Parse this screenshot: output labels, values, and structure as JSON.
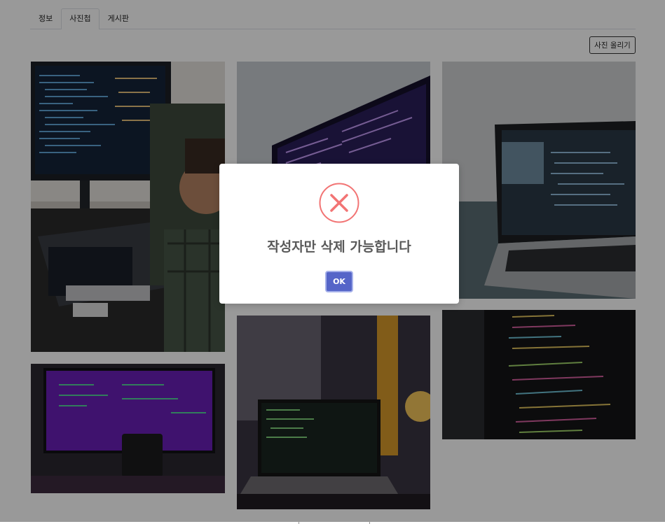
{
  "tabs": [
    {
      "label": "정보",
      "active": false
    },
    {
      "label": "사진첩",
      "active": true
    },
    {
      "label": "게시판",
      "active": false
    }
  ],
  "toolbar": {
    "upload_label": "사진 올리기"
  },
  "photos": [
    {
      "icon": "developer-with-monitors-photo"
    },
    {
      "icon": "curved-monitor-code-photo"
    },
    {
      "icon": "laptop-on-desk-photo"
    },
    {
      "icon": "purple-monitor-with-mug-photo"
    },
    {
      "icon": "laptop-with-lamp-photo"
    },
    {
      "icon": "python-code-screen-photo"
    }
  ],
  "dialog": {
    "icon": "error-x-icon",
    "message": "작성자만 삭제 가능합니다",
    "ok_label": "OK",
    "accent": "#e87c7c",
    "button_color": "#5565c8"
  }
}
